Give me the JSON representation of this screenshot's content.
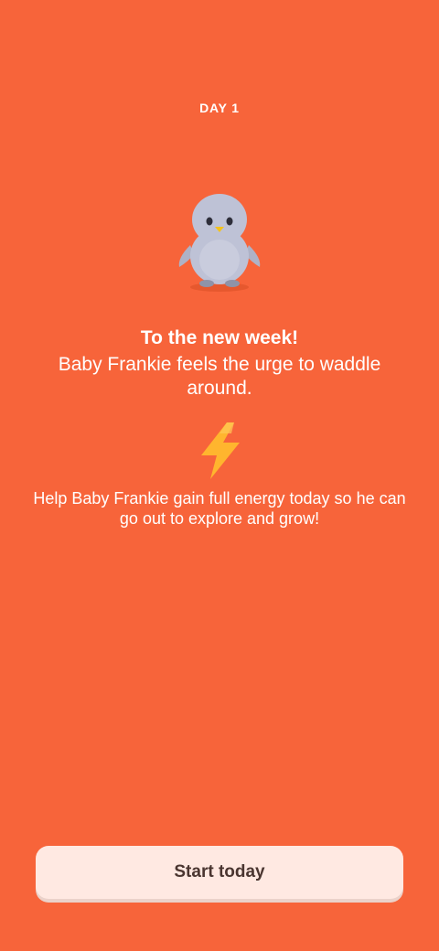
{
  "header": {
    "day_label": "DAY 1"
  },
  "mascot": {
    "icon": "penguin-icon",
    "color": "#BEC2D6"
  },
  "message": {
    "title": "To the new week!",
    "subtitle": "Baby Frankie feels the urge to waddle around.",
    "energy_icon": "lightning-bolt-icon",
    "body": "Help Baby Frankie gain full energy today so he can go out to explore and grow!"
  },
  "actions": {
    "start_label": "Start today"
  },
  "colors": {
    "background": "#F7643A",
    "button_background": "#FFE9E2",
    "button_text": "#4A3530",
    "bolt": "#FFB52E"
  }
}
